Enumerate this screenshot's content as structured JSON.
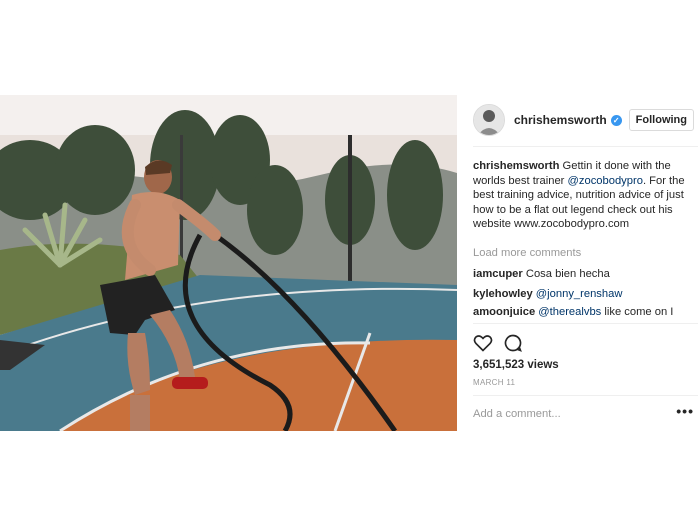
{
  "post": {
    "username": "chrishemsworth",
    "verified_mark": "✓",
    "follow_label": "Following",
    "caption": {
      "user": "chrishemsworth",
      "text_1": " Gettin it done with the worlds best trainer ",
      "mention": "@zocobodypro",
      "text_2": ". For the best training advice, nutrition advice of just how to be a flat out legend check out his website www.zocobodypro.com"
    },
    "load_more": "Load more comments",
    "comments": [
      {
        "user": "iamcuper",
        "mention": "",
        "text": " Cosa bien hecha"
      },
      {
        "user": "kylehowley",
        "mention": " @jonny_renshaw",
        "text": ""
      },
      {
        "user": "amoonjuice",
        "mention": " @therealvbs",
        "text": " like come on I"
      }
    ],
    "views": "3,651,523 views",
    "date": "MARCH 11",
    "add_comment_placeholder": "Add a comment...",
    "more_options": "•••"
  },
  "icons": {
    "like": "heart-icon",
    "comment": "comment-icon",
    "verified": "verified-badge-icon",
    "more": "more-options-icon"
  },
  "colors": {
    "link": "#003569",
    "verified": "#3897f0",
    "muted": "#999999",
    "court_blue": "#4a7a8c",
    "court_orange": "#c9703b"
  }
}
